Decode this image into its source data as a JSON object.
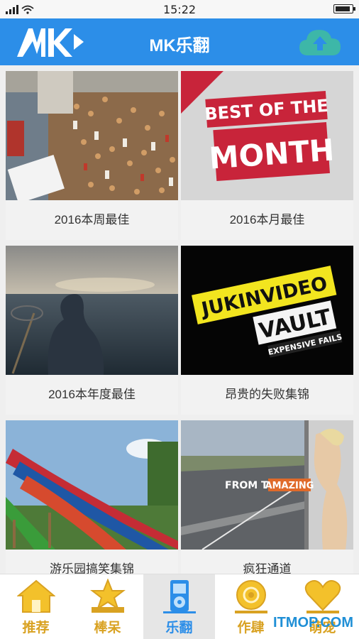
{
  "status_bar": {
    "time": "15:22",
    "battery_level": 0.85
  },
  "header": {
    "title": "MK乐翻",
    "logo_icon": "mk-logo-icon",
    "upload_icon": "cloud-upload-icon",
    "accent": "#2c8ee8"
  },
  "videos": [
    {
      "title": "2016本周最佳",
      "thumb_icon": "crowd-street-thumbnail"
    },
    {
      "title": "2016本月最佳",
      "thumb_icon": "best-of-the-month-thumbnail",
      "thumb_text": [
        "BEST OF THE",
        "MONTH"
      ]
    },
    {
      "title": "2016本年度最佳",
      "thumb_icon": "man-at-sea-thumbnail"
    },
    {
      "title": "昂贵的失败集锦",
      "thumb_icon": "jukinvideo-vault-thumbnail",
      "thumb_text": [
        "JUKINVIDEO",
        "VAULT",
        "EXPENSIVE FAILS"
      ]
    },
    {
      "title": "游乐园搞笑集锦",
      "thumb_icon": "waterpark-slides-thumbnail"
    },
    {
      "title": "疯狂通道",
      "thumb_icon": "race-track-thumbnail",
      "thumb_text": [
        "FROM THE",
        "AMAZING"
      ]
    }
  ],
  "tabs": [
    {
      "label": "推荐",
      "icon": "home-icon",
      "active": false
    },
    {
      "label": "棒呆",
      "icon": "star-icon",
      "active": false
    },
    {
      "label": "乐翻",
      "icon": "media-player-icon",
      "active": true
    },
    {
      "label": "作肆",
      "icon": "disc-icon",
      "active": false
    },
    {
      "label": "萌宠",
      "icon": "heart-icon",
      "active": false
    }
  ],
  "watermark": "ITMOP.COM",
  "colors": {
    "tab_gold": "#d9a222",
    "tab_active": "#2c8ee8"
  }
}
